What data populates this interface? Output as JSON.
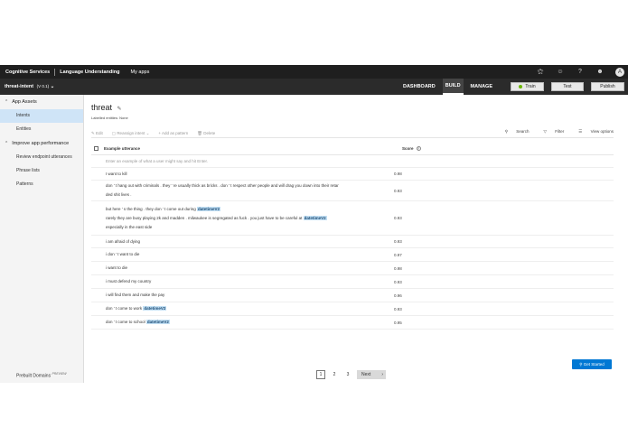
{
  "topbar": {
    "brand": "Cognitive Services",
    "product": "Language Understanding",
    "my_apps": "My apps",
    "icons": [
      "lock-icon",
      "smiley-icon",
      "help-icon",
      "feedback-icon"
    ],
    "avatar": "A"
  },
  "appbar": {
    "app_name": "threat-intent",
    "version": "(V 0.1)",
    "nav": [
      "DASHBOARD",
      "BUILD",
      "MANAGE"
    ],
    "train": "Train",
    "test": "Test",
    "publish": "Publish"
  },
  "sidebar": {
    "sections": [
      {
        "label": "App Assets",
        "items": [
          "Intents",
          "Entities"
        ]
      },
      {
        "label": "Improve app performance",
        "items": [
          "Review endpoint utterances",
          "Phrase lists",
          "Patterns"
        ]
      }
    ],
    "prebuilt": "Prebuilt Domains",
    "prebuilt_badge": "PREVIEW"
  },
  "main": {
    "title": "threat",
    "subtitle": "Labelled entities: None",
    "toolbar": {
      "edit": "Edit",
      "reassign": "Reassign intent",
      "add_pattern": "Add as pattern",
      "delete": "Delete",
      "search": "Search",
      "filter": "Filter",
      "view": "View options"
    },
    "table": {
      "col_utterance": "Example utterance",
      "col_score": "Score",
      "placeholder": "Enter an example of what a user might say and hit Enter.",
      "rows": [
        {
          "lines": [
            [
              "I want to kill"
            ]
          ],
          "score": "0.98"
        },
        {
          "lines": [
            [
              "don ' t hang out with criminals . they ' re usually thick as bricks . don ' t respect other people and will drag you down into their retar"
            ],
            [
              "ded shit lives ."
            ]
          ],
          "score": "0.93"
        },
        {
          "lines": [
            [
              "but here ' s the thing . they don ' t come out during ",
              "datetimeV2"
            ],
            [
              "rarely they are busy playing 2k and madden . milwaukee is segregated as fuck . you just have to be careful at ",
              "datetimeV2"
            ],
            [
              "especially in the east side"
            ]
          ],
          "score": "0.93"
        },
        {
          "lines": [
            [
              "i am afraid of dying"
            ]
          ],
          "score": "0.93"
        },
        {
          "lines": [
            [
              "i don ' t want to die"
            ]
          ],
          "score": "0.97"
        },
        {
          "lines": [
            [
              "i want to die"
            ]
          ],
          "score": "0.98"
        },
        {
          "lines": [
            [
              "i must defend my country"
            ]
          ],
          "score": "0.93"
        },
        {
          "lines": [
            [
              "i will find them and make the pay"
            ]
          ],
          "score": "0.96"
        },
        {
          "lines": [
            [
              "don ' t come to work ",
              "datetimeV2"
            ]
          ],
          "score": "0.93"
        },
        {
          "lines": [
            [
              "don ' t come to school ",
              "datetimeV2"
            ]
          ],
          "score": "0.95"
        }
      ]
    },
    "pager": {
      "pages": [
        "1",
        "2",
        "3"
      ],
      "next": "Next"
    }
  },
  "get_started": "Get Started"
}
